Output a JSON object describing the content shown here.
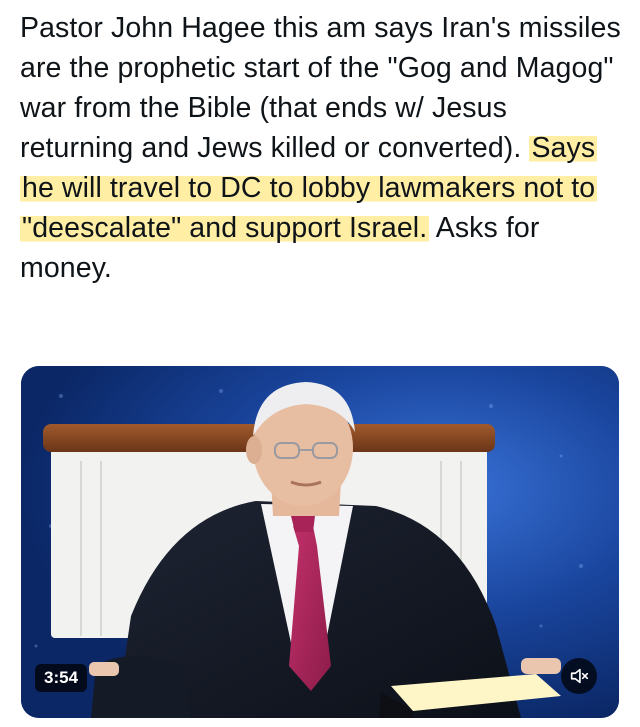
{
  "post": {
    "text_part1": "Pastor John Hagee this am says Iran's missiles are the prophetic start of the \"Gog and Magog\" war from the Bible (that ends w/ Jesus returning and Jews killed or converted).",
    "text_highlighted": "Says he will travel to DC to lobby lawmakers not to \"deescalate\" and support Israel.",
    "text_part2": "Asks for money."
  },
  "video": {
    "duration": "3:54",
    "mute_icon": "speaker-muted-icon"
  },
  "colors": {
    "text": "#0f1419",
    "highlight": "#ffe15a",
    "video_bg": "#153e96"
  }
}
